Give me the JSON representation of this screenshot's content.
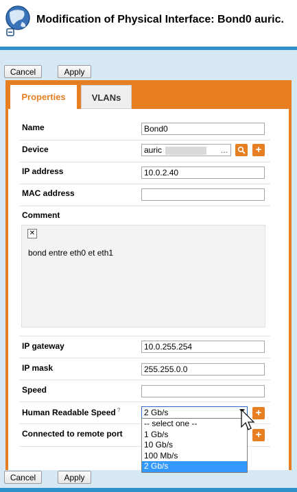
{
  "window": {
    "title": "Modification of Physical Interface: Bond0 auric."
  },
  "toolbar": {
    "cancel_label": "Cancel",
    "apply_label": "Apply"
  },
  "tabs": [
    {
      "label": "Properties",
      "active": true
    },
    {
      "label": "VLANs",
      "active": false
    }
  ],
  "form": {
    "name": {
      "label": "Name",
      "value": "Bond0"
    },
    "device": {
      "label": "Device",
      "value": "auric",
      "ellipsis": "..."
    },
    "ip_address": {
      "label": "IP address",
      "value": "10.0.2.40"
    },
    "mac_address": {
      "label": "MAC address",
      "value": ""
    },
    "comment": {
      "label": "Comment",
      "value": "bond entre eth0 et eth1"
    },
    "ip_gateway": {
      "label": "IP gateway",
      "value": "10.0.255.254"
    },
    "ip_mask": {
      "label": "IP mask",
      "value": "255.255.0.0"
    },
    "speed": {
      "label": "Speed",
      "value": ""
    },
    "human_speed": {
      "label": "Human Readable Speed",
      "help_mark": "?",
      "value": "2 Gb/s",
      "options": [
        "-- select one --",
        "1 Gb/s",
        "10 Gb/s",
        "100 Mb/s",
        "2 Gb/s"
      ],
      "selected_index": 4
    },
    "remote_port": {
      "label": "Connected to remote port"
    }
  },
  "icons": {
    "add": "+",
    "search": "search-icon",
    "fullscreen": "expand-icon"
  },
  "colors": {
    "accent": "#e77e22",
    "header_bar": "#2f8fc9",
    "background": "#d6e8f3",
    "selection": "#3399ff"
  }
}
